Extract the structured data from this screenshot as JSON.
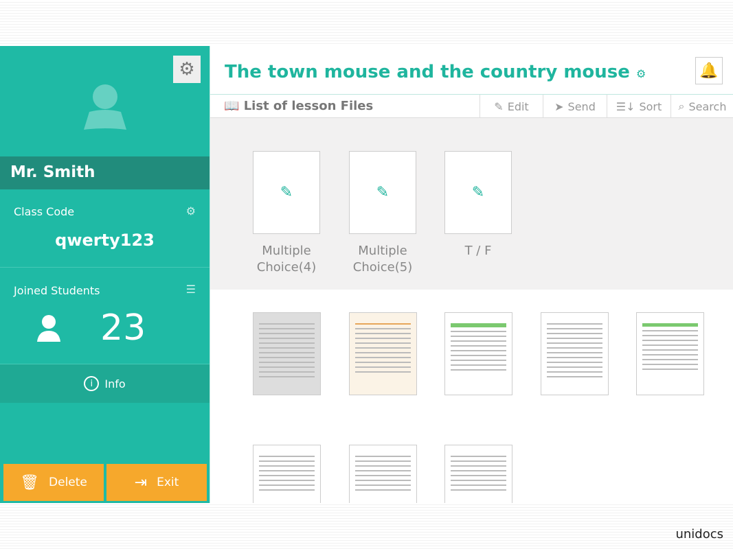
{
  "sidebar": {
    "teacher_name": "Mr. Smith",
    "class_code_label": "Class Code",
    "class_code": "qwerty123",
    "joined_label": "Joined Students",
    "joined_count": "23",
    "info_label": "Info",
    "delete_label": "Delete",
    "exit_label": "Exit"
  },
  "header": {
    "title": "The town mouse and the country mouse"
  },
  "toolbar": {
    "title": "List of lesson Files",
    "edit": "Edit",
    "send": "Send",
    "sort": "Sort",
    "search": "Search"
  },
  "templates": [
    {
      "line1": "Multiple",
      "line2": "Choice(4)"
    },
    {
      "line1": "Multiple",
      "line2": "Choice(5)"
    },
    {
      "line1": "T / F",
      "line2": ""
    }
  ],
  "footer": {
    "logo": "unidocs"
  },
  "colors": {
    "teal": "#1fbaa5",
    "dark_teal": "#218c7c",
    "orange": "#f6a82c"
  }
}
